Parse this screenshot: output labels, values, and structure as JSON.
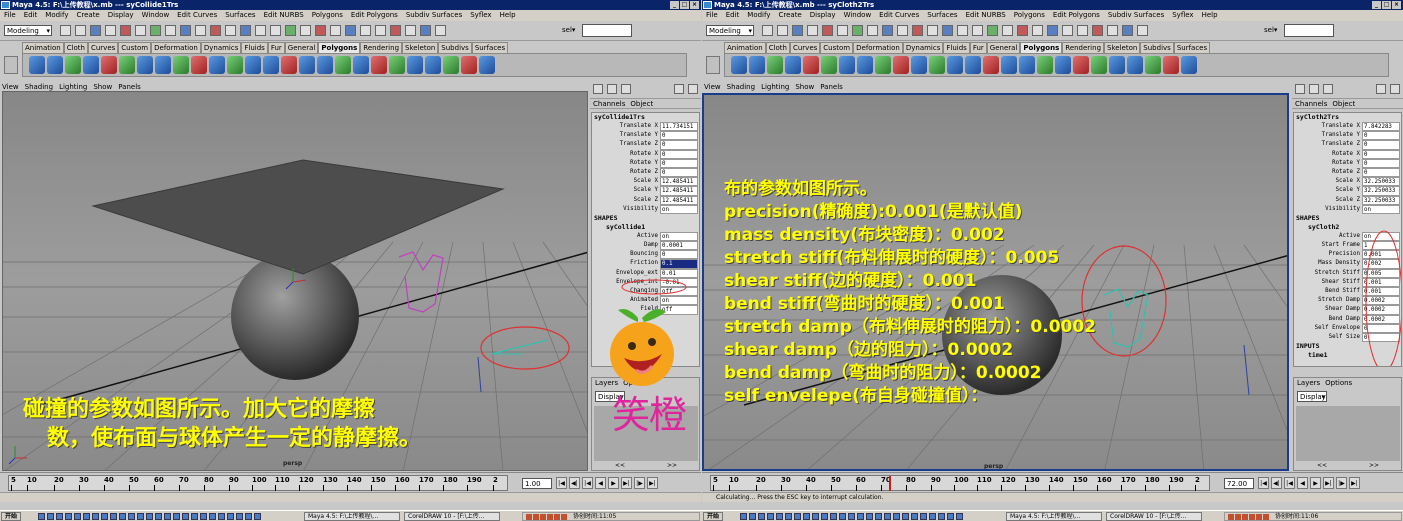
{
  "windows": [
    {
      "title": "Maya 4.5: F:\\上传教程\\x.mb  ---  syCollide1Trs",
      "menu": [
        "File",
        "Edit",
        "Modify",
        "Create",
        "Display",
        "Window",
        "Edit Curves",
        "Surfaces",
        "Edit NURBS",
        "Polygons",
        "Edit Polygons",
        "Subdiv Surfaces",
        "Syflex",
        "Help"
      ],
      "mode": "Modeling",
      "sel_label": "sel▾",
      "shelf_tabs": [
        "Animation",
        "Cloth",
        "Curves",
        "Custom",
        "Deformation",
        "Dynamics",
        "Fluids",
        "Fur",
        "General",
        "Polygons",
        "Rendering",
        "Skeleton",
        "Subdivs",
        "Surfaces"
      ],
      "active_shelf": "Polygons",
      "viewport_menu": [
        "View",
        "Shading",
        "Lighting",
        "Show",
        "Panels"
      ],
      "camera": "persp",
      "channels_tabs": [
        "Channels",
        "Object"
      ],
      "node": "syCollide1Trs",
      "transform_attrs": [
        {
          "label": "Translate X",
          "value": "11.734151"
        },
        {
          "label": "Translate Y",
          "value": "0"
        },
        {
          "label": "Translate Z",
          "value": "0"
        },
        {
          "label": "Rotate X",
          "value": "0"
        },
        {
          "label": "Rotate Y",
          "value": "0"
        },
        {
          "label": "Rotate Z",
          "value": "0"
        },
        {
          "label": "Scale X",
          "value": "12.485411"
        },
        {
          "label": "Scale Y",
          "value": "12.485411"
        },
        {
          "label": "Scale Z",
          "value": "12.485411"
        },
        {
          "label": "Visibility",
          "value": "on"
        }
      ],
      "shapes_label": "SHAPES",
      "shape_node": "syCollide1",
      "shape_attrs": [
        {
          "label": "Active",
          "value": "on"
        },
        {
          "label": "Damp",
          "value": "0.0001"
        },
        {
          "label": "Bouncing",
          "value": "0"
        },
        {
          "label": "Friction",
          "value": "0.1"
        },
        {
          "label": "Envelope_ext",
          "value": "0.01"
        },
        {
          "label": "Envelope_int",
          "value": "-0.01"
        },
        {
          "label": "Changing",
          "value": "off"
        },
        {
          "label": "Animated",
          "value": "on"
        },
        {
          "label": "Field",
          "value": "off"
        }
      ],
      "highlighted_attr": "Friction",
      "layers_tabs": [
        "Layers",
        "Options"
      ],
      "layers_mode": "Display",
      "layers_nav": [
        "<<",
        ">>"
      ],
      "current_frame": "1.00",
      "helpline": "",
      "annotation": [
        "碰撞的参数如图所示。加大它的摩擦",
        "数，使布面与球体产生一定的静摩擦。"
      ]
    },
    {
      "title": "Maya 4.5: F:\\上传教程\\x.mb  ---  syCloth2Trs",
      "menu": [
        "File",
        "Edit",
        "Modify",
        "Create",
        "Display",
        "Window",
        "Edit Curves",
        "Surfaces",
        "Edit NURBS",
        "Polygons",
        "Edit Polygons",
        "Subdiv Surfaces",
        "Syflex",
        "Help"
      ],
      "mode": "Modeling",
      "sel_label": "sel▾",
      "shelf_tabs": [
        "Animation",
        "Cloth",
        "Curves",
        "Custom",
        "Deformation",
        "Dynamics",
        "Fluids",
        "Fur",
        "General",
        "Polygons",
        "Rendering",
        "Skeleton",
        "Subdivs",
        "Surfaces"
      ],
      "active_shelf": "Polygons",
      "viewport_menu": [
        "View",
        "Shading",
        "Lighting",
        "Show",
        "Panels"
      ],
      "camera": "persp",
      "channels_tabs": [
        "Channels",
        "Object"
      ],
      "node": "syCloth2Trs",
      "transform_attrs": [
        {
          "label": "Translate X",
          "value": "7.842283"
        },
        {
          "label": "Translate Y",
          "value": "0"
        },
        {
          "label": "Translate Z",
          "value": "0"
        },
        {
          "label": "Rotate X",
          "value": "0"
        },
        {
          "label": "Rotate Y",
          "value": "0"
        },
        {
          "label": "Rotate Z",
          "value": "0"
        },
        {
          "label": "Scale X",
          "value": "32.250033"
        },
        {
          "label": "Scale Y",
          "value": "32.250033"
        },
        {
          "label": "Scale Z",
          "value": "32.250033"
        },
        {
          "label": "Visibility",
          "value": "on"
        }
      ],
      "shapes_label": "SHAPES",
      "shape_node": "syCloth2",
      "shape_attrs": [
        {
          "label": "Active",
          "value": "on"
        },
        {
          "label": "Start Frame",
          "value": "1"
        },
        {
          "label": "Precision",
          "value": "0.001"
        },
        {
          "label": "Mass Density",
          "value": "0.002"
        },
        {
          "label": "Stretch Stiff",
          "value": "0.005"
        },
        {
          "label": "Shear Stiff",
          "value": "0.001"
        },
        {
          "label": "Bend Stiff",
          "value": "0.001"
        },
        {
          "label": "Stretch Damp",
          "value": "0.0002"
        },
        {
          "label": "Shear Damp",
          "value": "0.0002"
        },
        {
          "label": "Bend Damp",
          "value": "0.0002"
        },
        {
          "label": "Self Envelope",
          "value": "0"
        },
        {
          "label": "Self Size",
          "value": "0"
        }
      ],
      "inputs_label": "INPUTS",
      "inputs_node": "time1",
      "layers_tabs": [
        "Layers",
        "Options"
      ],
      "layers_mode": "Display",
      "layers_nav": [
        "<<",
        ">>"
      ],
      "current_frame": "72.00",
      "helpline": "Calculating...  Press the ESC key to interrupt calculation.",
      "annotation": [
        "布的参数如图所示。",
        "precision(精确度):0.001(是默认值)",
        "mass density(布块密度)：0.002",
        "stretch stiff(布料伸展时的硬度）：0.005",
        "shear stiff(边的硬度）：0.001",
        "bend stiff(弯曲时的硬度）：0.001",
        "stretch damp（布料伸展时的阻力）：0.0002",
        "shear damp（边的阻力）：0.0002",
        "bend damp（弯曲时的阻力）：0.0002",
        "self envelepe(布自身碰撞值）："
      ]
    }
  ],
  "timeline_ticks": [
    "5",
    "10",
    "20",
    "30",
    "40",
    "50",
    "60",
    "70",
    "80",
    "90",
    "100",
    "110",
    "120",
    "130",
    "140",
    "150",
    "160",
    "170",
    "180",
    "190",
    "2"
  ],
  "watermark": "笑橙",
  "taskbar": {
    "start": "开始",
    "maya_task": "Maya 4.5: F:\\上传教程\\...",
    "corel_task": "CorelDRAW 10 - [F:\\上传...",
    "clock_left": "协创时间:11:05",
    "clock_right": "协创时间:11:06"
  },
  "colors": {
    "annotation": "#ffff00",
    "title_bar": "#0a246a",
    "watermark": "#e0259c",
    "mascot": "#f7a21b"
  }
}
